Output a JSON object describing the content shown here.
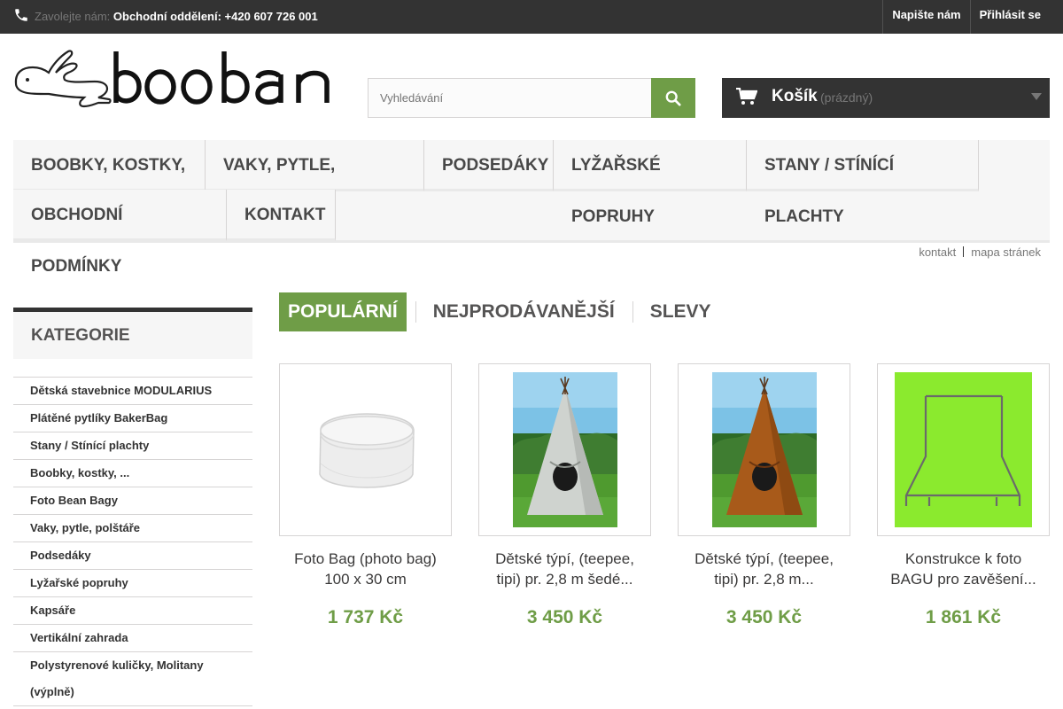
{
  "topbar": {
    "call_prefix": "Zavolejte nám:",
    "call_text": "Obchodní oddělení: +420 607 726 001",
    "links": [
      "Napište nám",
      "Přihlásit se"
    ]
  },
  "header": {
    "logo_text": "booban",
    "search": {
      "placeholder": "Vyhledávání"
    },
    "cart": {
      "label": "Košík",
      "status": "(prázdný)"
    }
  },
  "menu": [
    "Boobky, kostky, ...",
    "Vaky, pytle, polštáře",
    "Podsedáky",
    "Lyžařské popruhy",
    "Stany / stínící plachty",
    "Obchodní podmínky",
    "Kontakt"
  ],
  "sublinks": [
    "kontakt",
    "mapa stránek"
  ],
  "categories": {
    "title": "Kategorie",
    "items": [
      "Dětská stavebnice MODULARIUS",
      "Plátěné pytlíky BakerBag",
      "Stany / Stínící plachty",
      "Boobky, kostky, ...",
      "Foto Bean Bagy",
      "Vaky, pytle, polštáře",
      "Podsedáky",
      "Lyžařské popruhy",
      "Kapsáře",
      "Vertikální zahrada",
      "Polystyrenové kuličky, Molitany (výplně)"
    ]
  },
  "tabs": [
    "Populární",
    "Nejprodávanější",
    "Slevy"
  ],
  "products": [
    {
      "name": "Foto Bag (photo bag) 100 x 30 cm",
      "price": "1 737 Kč"
    },
    {
      "name": "Dětské týpí, (teepee, tipi) pr. 2,8 m šedé...",
      "price": "3 450 Kč"
    },
    {
      "name": "Dětské týpí, (teepee, tipi) pr. 2,8 m...",
      "price": "3 450 Kč"
    },
    {
      "name": "Konstrukce k foto BAGU pro zavěšení...",
      "price": "1 861 Kč"
    }
  ],
  "colors": {
    "accent": "#6f9d47",
    "dark": "#333333"
  }
}
